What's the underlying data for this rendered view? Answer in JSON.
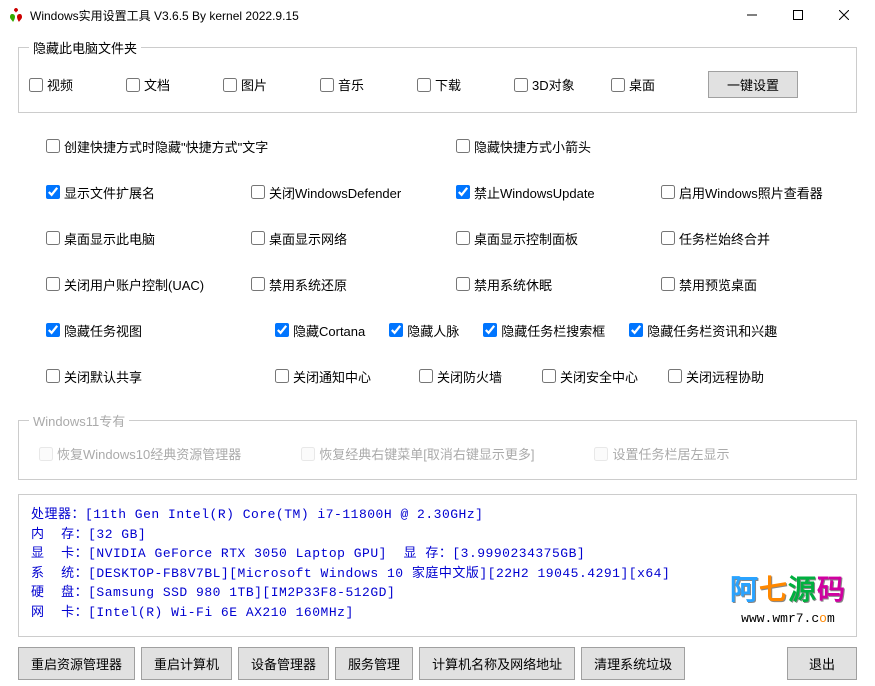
{
  "window": {
    "title": "Windows实用设置工具 V3.6.5 By kernel 2022.9.15"
  },
  "group_folders": {
    "legend": "隐藏此电脑文件夹",
    "items": [
      "视频",
      "文档",
      "图片",
      "音乐",
      "下载",
      "3D对象",
      "桌面"
    ],
    "one_key": "一键设置"
  },
  "settings": {
    "row1": [
      {
        "label": "创建快捷方式时隐藏\"快捷方式\"文字",
        "checked": false,
        "cls": "c1 wide"
      },
      {
        "label": "隐藏快捷方式小箭头",
        "checked": false,
        "cls": "c3"
      }
    ],
    "row2": [
      {
        "label": "显示文件扩展名",
        "checked": true,
        "cls": "c1"
      },
      {
        "label": "关闭WindowsDefender",
        "checked": false,
        "cls": "c2"
      },
      {
        "label": "禁止WindowsUpdate",
        "checked": true,
        "cls": "c3"
      },
      {
        "label": "启用Windows照片查看器",
        "checked": false,
        "cls": "c4"
      }
    ],
    "row3": [
      {
        "label": "桌面显示此电脑",
        "checked": false,
        "cls": "c1"
      },
      {
        "label": "桌面显示网络",
        "checked": false,
        "cls": "c2"
      },
      {
        "label": "桌面显示控制面板",
        "checked": false,
        "cls": "c3"
      },
      {
        "label": "任务栏始终合并",
        "checked": false,
        "cls": "c4"
      }
    ],
    "row4": [
      {
        "label": "关闭用户账户控制(UAC)",
        "checked": false,
        "cls": "c1"
      },
      {
        "label": "禁用系统还原",
        "checked": false,
        "cls": "c2"
      },
      {
        "label": "禁用系统休眠",
        "checked": false,
        "cls": "c3"
      },
      {
        "label": "禁用预览桌面",
        "checked": false,
        "cls": "c4"
      }
    ],
    "row5": [
      {
        "label": "隐藏任务视图",
        "checked": true,
        "cls": ""
      },
      {
        "label": "隐藏Cortana",
        "checked": true,
        "cls": ""
      },
      {
        "label": "隐藏人脉",
        "checked": true,
        "cls": ""
      },
      {
        "label": "隐藏任务栏搜索框",
        "checked": true,
        "cls": ""
      },
      {
        "label": "隐藏任务栏资讯和兴趣",
        "checked": true,
        "cls": ""
      }
    ],
    "row6": [
      {
        "label": "关闭默认共享",
        "checked": false,
        "cls": ""
      },
      {
        "label": "关闭通知中心",
        "checked": false,
        "cls": ""
      },
      {
        "label": "关闭防火墙",
        "checked": false,
        "cls": ""
      },
      {
        "label": "关闭安全中心",
        "checked": false,
        "cls": ""
      },
      {
        "label": "关闭远程协助",
        "checked": false,
        "cls": ""
      }
    ]
  },
  "win11": {
    "legend": "Windows11专有",
    "items": [
      "恢复Windows10经典资源管理器",
      "恢复经典右键菜单[取消右键显示更多]",
      "设置任务栏居左显示"
    ]
  },
  "sysinfo": {
    "lines": [
      "处理器：[11th Gen Intel(R) Core(TM) i7-11800H @ 2.30GHz]",
      "内  存：[32 GB]",
      "显  卡：[NVIDIA GeForce RTX 3050 Laptop GPU]  显 存：[3.9990234375GB]",
      "系  统：[DESKTOP-FB8V7BL][Microsoft Windows 10 家庭中文版][22H2 19045.4291][x64]",
      "硬  盘：[Samsung SSD 980 1TB][IM2P33F8-512GD]",
      "网  卡：[Intel(R) Wi-Fi 6E AX210 160MHz]"
    ]
  },
  "watermark": {
    "text": "阿七源码",
    "url_pre": "www.wmr7.c",
    "url_o": "o",
    "url_post": "m"
  },
  "buttons": {
    "b1": "重启资源管理器",
    "b2": "重启计算机",
    "b3": "设备管理器",
    "b4": "服务管理",
    "b5": "计算机名称及网络地址",
    "b6": "清理系统垃圾",
    "b7": "退出"
  }
}
